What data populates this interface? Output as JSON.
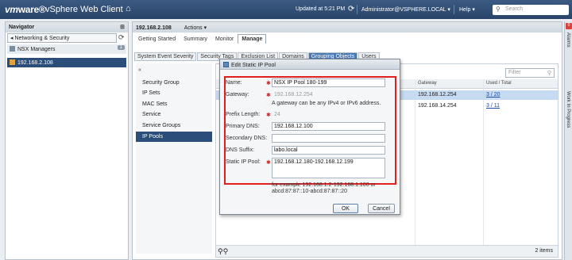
{
  "topbar": {
    "logo_vm": "vm",
    "logo_ware": "ware®",
    "product": "vSphere Web Client",
    "home_icon": "home-icon",
    "updated": "Updated at 5:21 PM",
    "user": "Administrator@VSPHERE.LOCAL ▾",
    "help": "Help ▾",
    "search_placeholder": "Search"
  },
  "navigator": {
    "title": "Navigator",
    "breadcrumb": "◂ Networking & Security",
    "items": [
      {
        "label": "NSX Managers",
        "count": "1"
      },
      {
        "label": "192.168.2.108"
      }
    ]
  },
  "main": {
    "object": "192.168.2.108",
    "actions": "Actions ▾",
    "tabs": [
      "Getting Started",
      "Summary",
      "Monitor",
      "Manage"
    ],
    "active_tab": "Manage",
    "subtabs": [
      "System Event Severity",
      "Security Tags",
      "Exclusion List",
      "Domains",
      "Grouping Objects",
      "Users"
    ],
    "active_subtab": "Grouping Objects",
    "left_items": [
      "Security Group",
      "IP Sets",
      "MAC Sets",
      "Service",
      "Service Groups",
      "IP Pools"
    ],
    "selected_left": "IP Pools",
    "filter_placeholder": "Filter",
    "columns": [
      "Gateway",
      "Used / Total"
    ],
    "rows": [
      {
        "gateway": "192.168.12.254",
        "used": "3 / 20"
      },
      {
        "gateway": "192.168.14.254",
        "used": "3 / 11"
      }
    ],
    "footer_count": "2 items"
  },
  "rail": {
    "alarms": "Alarms",
    "alarm_count": "0",
    "work": "Work In Progress"
  },
  "dialog": {
    "title": "Edit Static IP Pool",
    "fields": {
      "name_label": "Name:",
      "name_value": "NSX IP Pool 180-199",
      "gateway_label": "Gateway:",
      "gateway_value": "192.168.12.254",
      "gateway_hint": "A gateway can be any IPv4 or IPv6 address.",
      "prefix_label": "Prefix Length:",
      "prefix_value": "24",
      "pdns_label": "Primary DNS:",
      "pdns_value": "192.168.12.100",
      "sdns_label": "Secondary DNS:",
      "sdns_value": "",
      "suffix_label": "DNS Suffix:",
      "suffix_value": "labo.local",
      "pool_label": "Static IP Pool:",
      "pool_value": "192.168.12.180-192.168.12.199",
      "pool_hint1": "for example 192.168.1.2-192.168.1.100 or",
      "pool_hint2": "abcd:87:87::10-abcd:87:87::20"
    },
    "ok": "OK",
    "cancel": "Cancel"
  }
}
